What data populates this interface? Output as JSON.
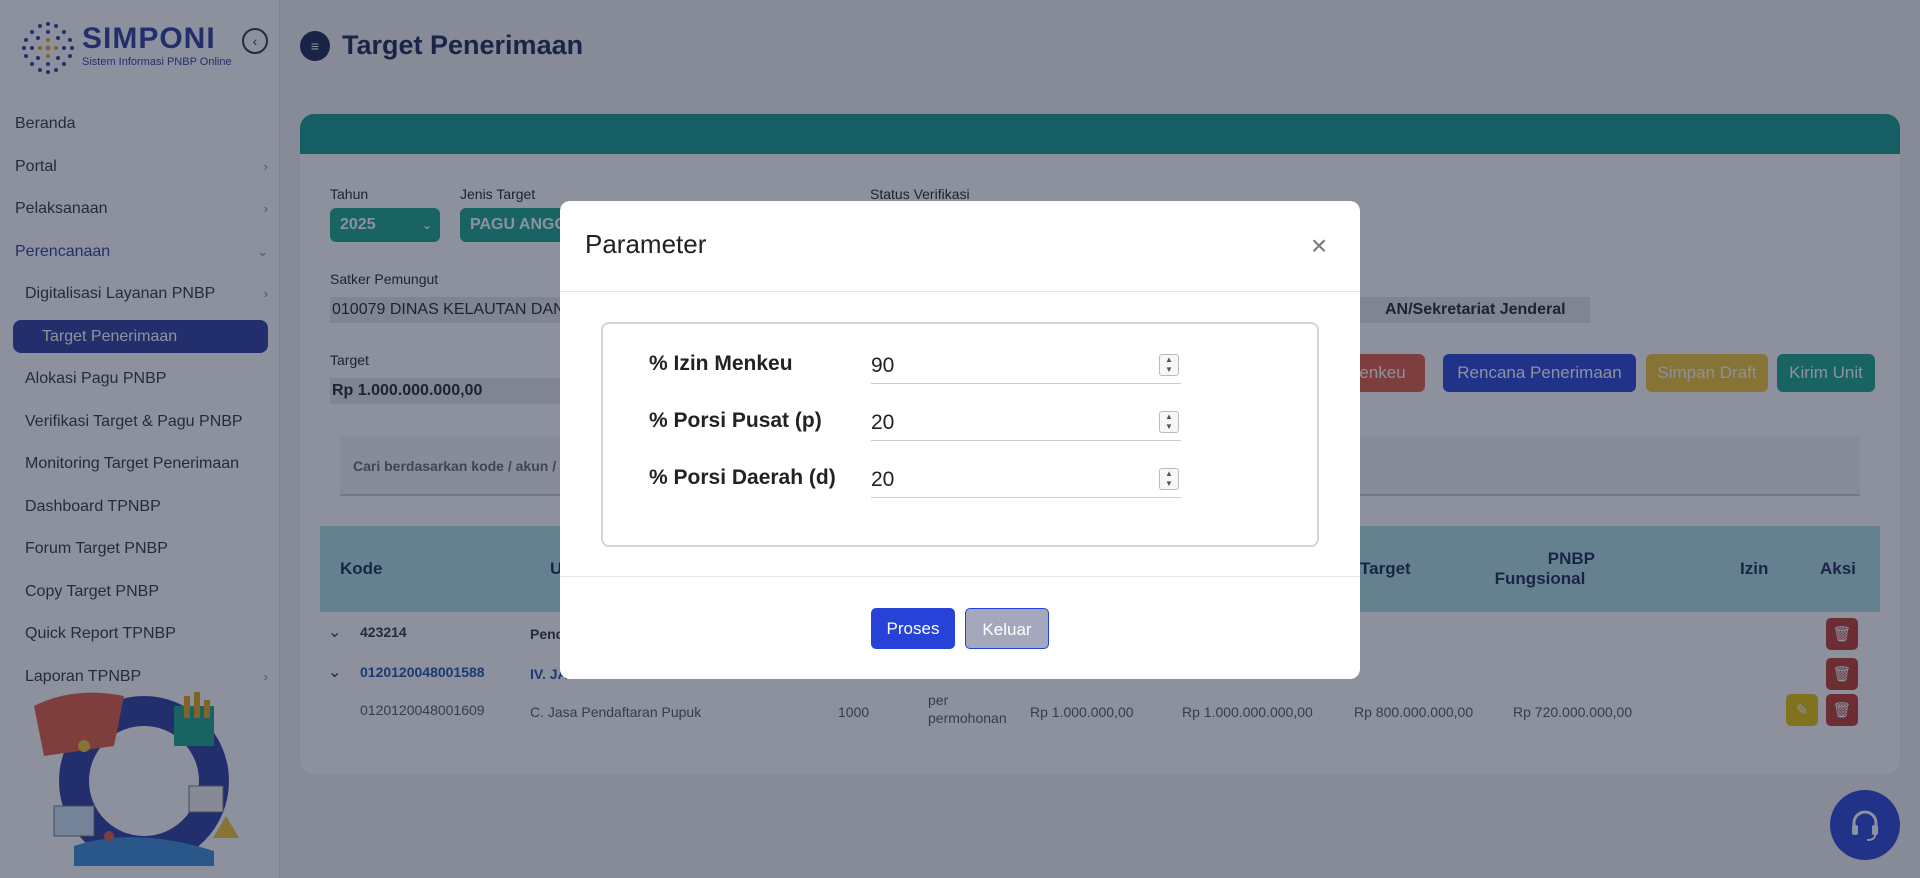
{
  "app": {
    "logo_title": "SIMPONI",
    "logo_subtitle": "Sistem Informasi PNBP Online"
  },
  "sidebar": {
    "items": [
      {
        "label": "Beranda"
      },
      {
        "label": "Portal"
      },
      {
        "label": "Pelaksanaan"
      },
      {
        "label": "Perencanaan"
      },
      {
        "label": "Digitalisasi Layanan PNBP"
      },
      {
        "label": "Target Penerimaan"
      },
      {
        "label": "Alokasi Pagu PNBP"
      },
      {
        "label": "Verifikasi Target & Pagu PNBP"
      },
      {
        "label": "Monitoring Target Penerimaan"
      },
      {
        "label": "Dashboard TPNBP"
      },
      {
        "label": "Forum Target PNBP"
      },
      {
        "label": "Copy Target PNBP"
      },
      {
        "label": "Quick Report TPNBP"
      },
      {
        "label": "Laporan TPNBP"
      }
    ]
  },
  "page": {
    "title": "Target Penerimaan"
  },
  "filters": {
    "tahun_label": "Tahun",
    "tahun_value": "2025",
    "jenis_target_label": "Jenis Target",
    "jenis_target_value": "PAGU ANGG",
    "status_verifikasi_label": "Status Verifikasi",
    "satker_label": "Satker Pemungut",
    "satker_value": "010079 DINAS KELAUTAN DAN",
    "satker_value_right": "AN/Sekretariat Jenderal",
    "target_label": "Target",
    "target_value": "Rp 1.000.000.000,00"
  },
  "actions": {
    "izin_menkeu_partial": "enkeu",
    "rencana_penerimaan": "Rencana Penerimaan",
    "simpan_draft": "Simpan Draft",
    "kirim_unit": "Kirim Unit"
  },
  "search": {
    "placeholder": "Cari berdasarkan kode / akun /"
  },
  "table": {
    "headers": {
      "kode": "Kode",
      "uraian_partial": "U",
      "target": "Target",
      "pnbp_fungsional_1": "PNBP",
      "pnbp_fungsional_2": "Fungsional",
      "izin": "Izin",
      "aksi": "Aksi"
    },
    "rows": [
      {
        "kode": "423214",
        "uraian": "Pend"
      },
      {
        "kode": "0120120048001588",
        "uraian": "IV. JA"
      },
      {
        "kode": "0120120048001609",
        "uraian": "C. Jasa Pendaftaran Pupuk",
        "volume": "1000",
        "satuan_1": "per",
        "satuan_2": "permohonan",
        "tarif": "Rp 1.000.000,00",
        "target": "Rp 1.000.000.000,00",
        "pnbp_fungsional": "Rp 800.000.000,00",
        "izin": "Rp 720.000.000,00"
      }
    ]
  },
  "modal": {
    "title": "Parameter",
    "params": [
      {
        "label": "% Izin Menkeu",
        "value": "90"
      },
      {
        "label": "% Porsi Pusat (p)",
        "value": "20"
      },
      {
        "label": "% Porsi Daerah (d)",
        "value": "20"
      }
    ],
    "proses_label": "Proses",
    "keluar_label": "Keluar"
  },
  "colors": {
    "primary": "#2d3a9e",
    "teal": "#10998a",
    "green": "#17a589",
    "danger": "#c0392b",
    "warning": "#e8c200"
  }
}
